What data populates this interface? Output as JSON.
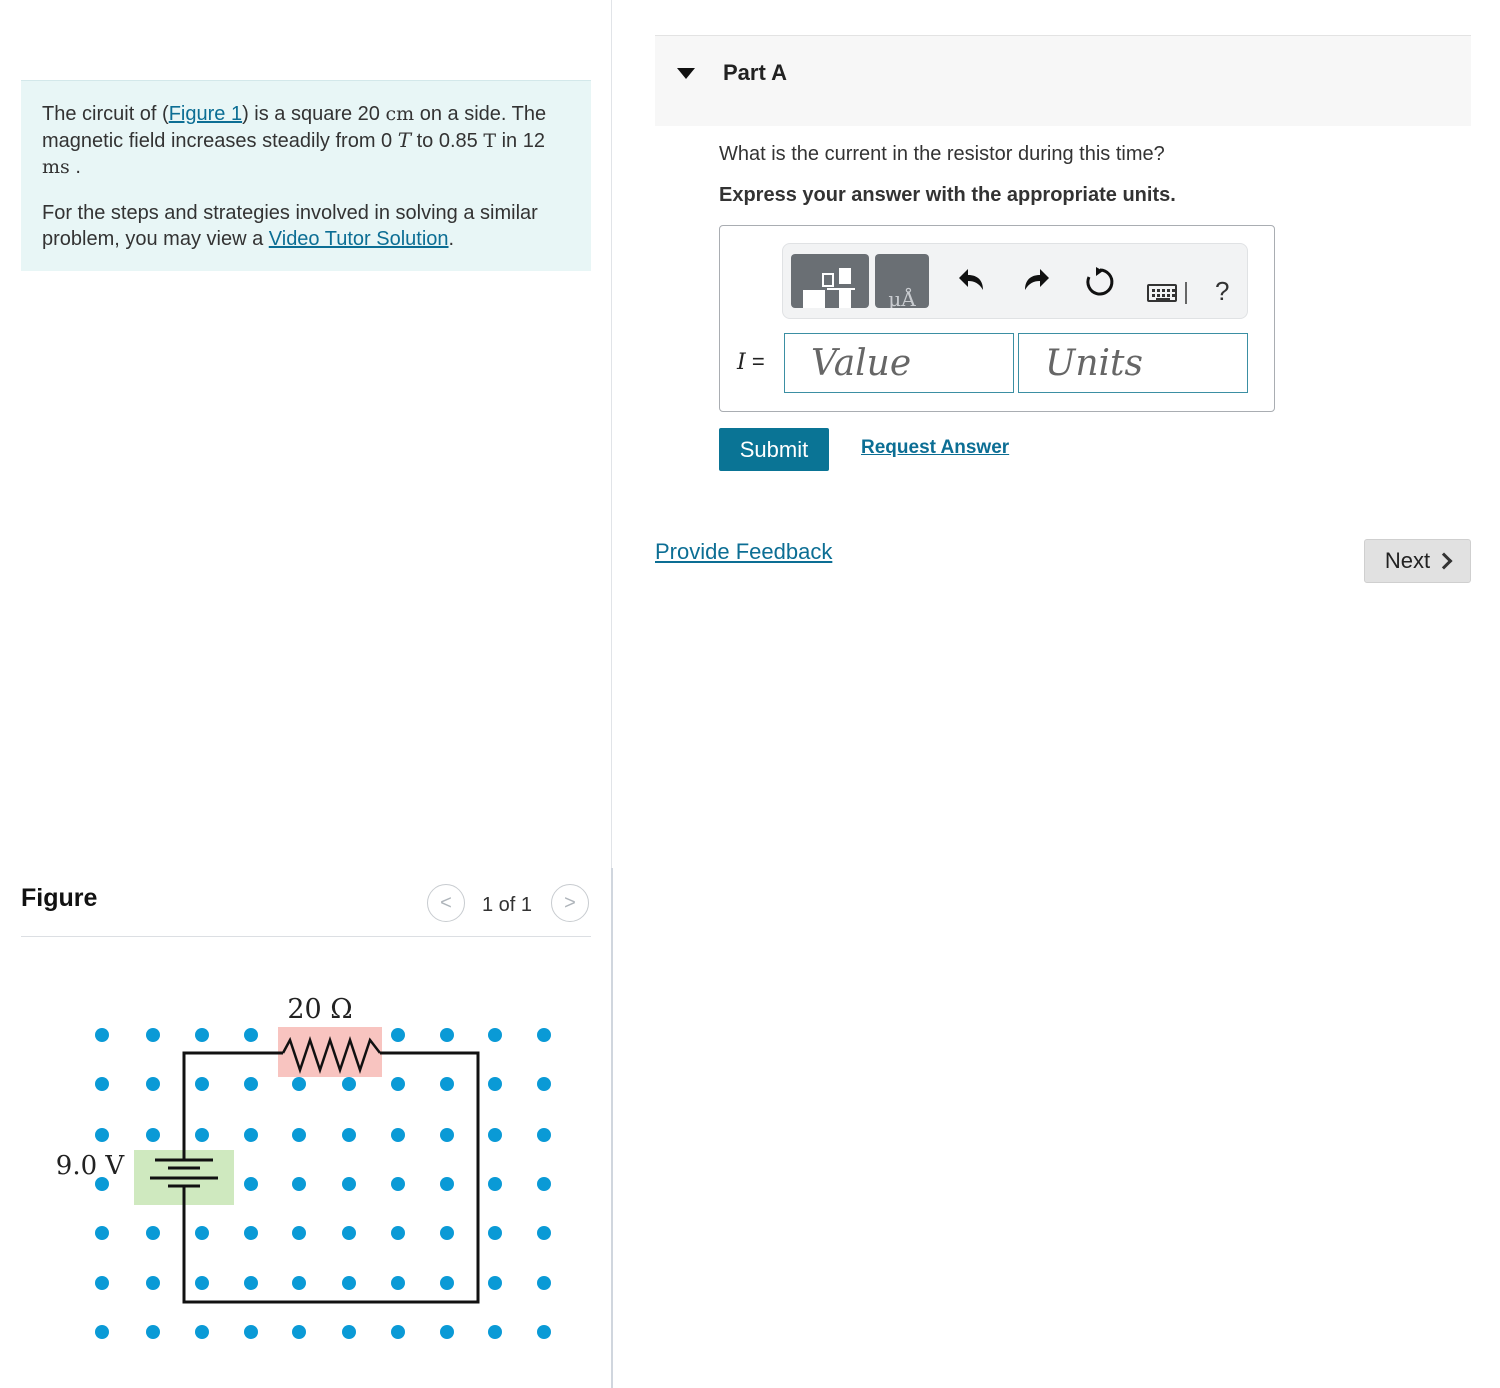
{
  "problem": {
    "text_1_pre": "The circuit of (",
    "figure_link": "Figure 1",
    "text_1_mid": ") is a square 20 ",
    "unit_cm": "cm",
    "text_1_mid2": " on a side. The magnetic field increases steadily from 0 ",
    "unit_T_italic": "T",
    "text_1_mid3": " to 0.85 ",
    "unit_T": "T",
    "text_1_mid4": " in 12 ",
    "unit_ms": "ms",
    "text_1_end": " .",
    "text_2_pre": "For the steps and strategies involved in solving a similar problem, you may view a ",
    "video_link": "Video Tutor Solution",
    "text_2_end": "."
  },
  "figure": {
    "title": "Figure",
    "pager_text": "1 of 1",
    "prev_glyph": "<",
    "next_glyph": ">",
    "resistor_label": "20 Ω",
    "battery_label": "9.0 V",
    "colors": {
      "dot": "#0a9ad6",
      "resistor_highlight": "#f8c4c0",
      "battery_highlight": "#cfe9bf",
      "wire": "#111111"
    }
  },
  "part": {
    "title": "Part A",
    "question": "What is the current in the resistor during this time?",
    "instruction": "Express your answer with the appropriate units.",
    "variable": "I",
    "equals": " =",
    "value_placeholder": "Value",
    "units_placeholder": "Units",
    "unit_tile_text": "μÅ",
    "help_glyph": "?",
    "submit_label": "Submit",
    "request_label": "Request Answer"
  },
  "footer": {
    "feedback_label": "Provide Feedback",
    "next_label": "Next"
  },
  "colors": {
    "accent": "#0a7495",
    "link": "#0c6e94",
    "problem_bg": "#e8f6f6"
  }
}
